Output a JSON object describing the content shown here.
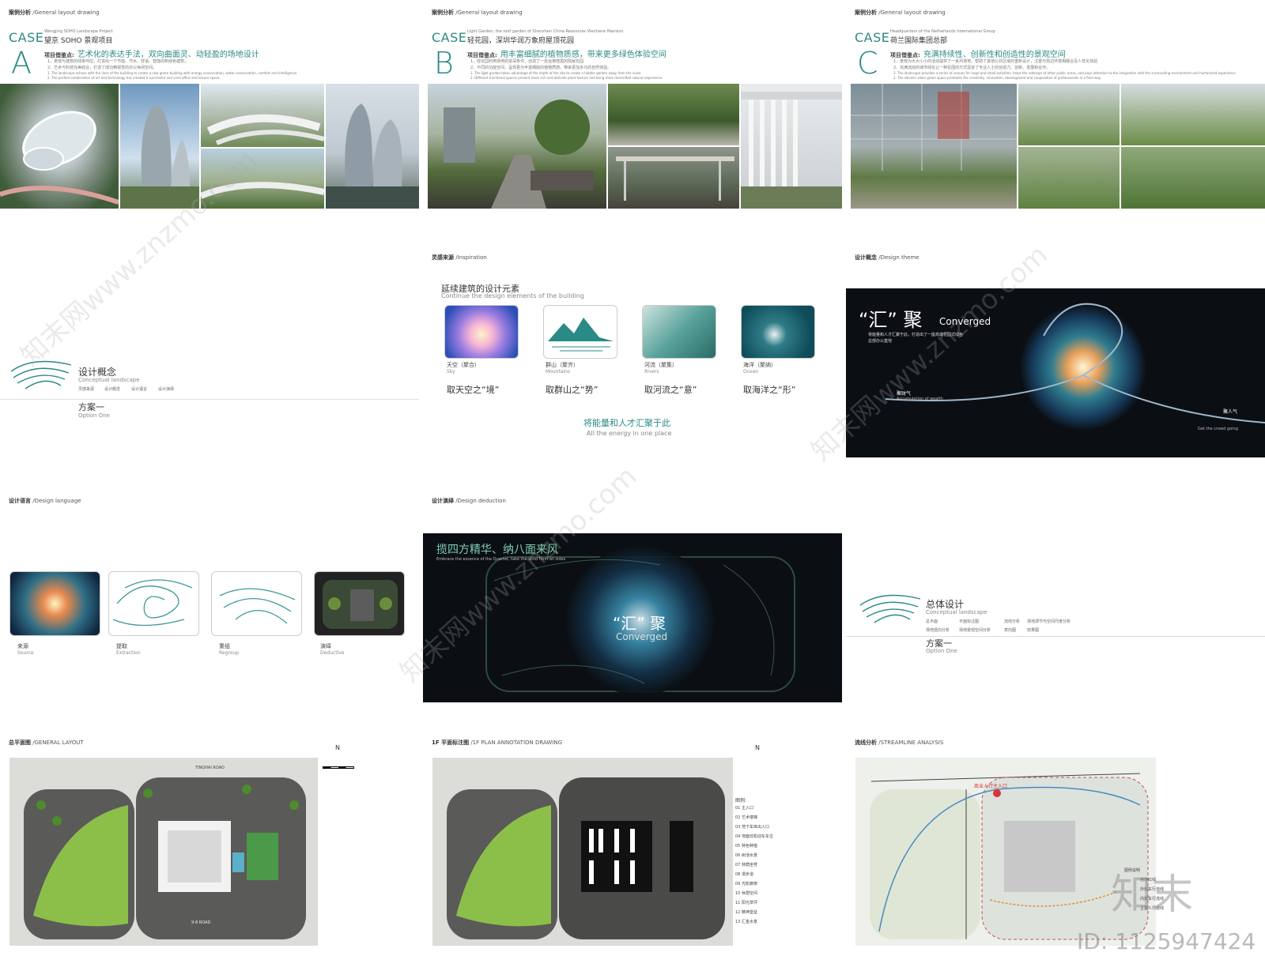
{
  "slides": {
    "caseA": {
      "sec": "案例分析",
      "sec_en": "/General layout drawing",
      "case": "CASE",
      "title": "望京 SOHO 景观项目",
      "title_en": "Wangjing SOHO Landscape Project",
      "letter": "A",
      "hl_label": "项目借鉴点:",
      "hl": "艺术化的表达手法，双向曲面灵、动轻盈的场地设计",
      "n1": "1、景观与建筑的线条呼应，打造出一个节能、节水、舒适、智能的新绿色建筑；",
      "n2": "2、艺术与科技完美结合，打造了成功精视觉的办公休闲空间。",
      "n3": "1. The landscape echoes with the lines of the building to create a new green building with energy conservation, water conservation, comfort and intelligence",
      "n4": "2. The perfect combination of art and technology has created a successful and vivid office and leisure space."
    },
    "caseB": {
      "sec": "案例分析",
      "sec_en": "/General layout drawing",
      "case": "CASE",
      "title": "轻花园，深圳华润万象府屋顶花园",
      "title_en": "Light Garden, the roof garden of Shenzhen China Resources Vientiane Mansion",
      "letter": "B",
      "hl_label": "项目借鉴点:",
      "hl": "用丰富细腻的植物质感，带来更多绿色体验空间",
      "n1": "1、轻花园利用场地的进深条件，创造了一处远离喧嚣的隐秘花园",
      "n2": "2、不同的功能空间，呈现更为丰富细腻的植物质感，带来更加多元的自然体验。",
      "n3": "1. The light garden takes advantage of the depth of the site to create a hidden garden away from the noise",
      "n4": "2. Different functional spaces present more rich and delicate plant texture and bring more diversified natural experience."
    },
    "caseC": {
      "sec": "案例分析",
      "sec_en": "/General layout drawing",
      "case": "CASE",
      "title": "荷兰国际集团总部",
      "title_en": "Headquarters of the Netherlands International Group",
      "letter": "C",
      "hl_label": "项目借鉴点:",
      "hl": "充满持续性、创新性和创造性的景观空间",
      "n1": "1、景观为大大小小的活动提供了一系列场地，帮助了其他公共区域的重新设计，注重与周边环境相融合及人性化体验",
      "n2": "2、充满流动的城市绿化让一种氛围的方式促进了专业人士的创造力、创新、发展和合作。",
      "n3": "1. The landscape provides a series of venues for large and small activities, helps the redesign of other public areas, and pays attention to the integration with the surrounding environment and humanized experience",
      "n4": "2. The vibrant urban green space promotes the creativity, innovation, development and cooperation of professionals in a fluid way."
    },
    "concept": {
      "title": "设计概念",
      "en": "Conceptual landscape",
      "subs": [
        "灵感来源",
        "设计概念",
        "设计语言",
        "设计演绎"
      ],
      "opt": "方案一",
      "opt_en": "Option  One"
    },
    "inspiration": {
      "sec": "灵感来源",
      "sec_en": "/Inspiration",
      "head": "延续建筑的设计元素",
      "head_en": "Continue the design elements of the building",
      "items": [
        {
          "cn": "天空（聚合）",
          "en": "Sky",
          "take": "取天空之“境”"
        },
        {
          "cn": "群山（聚齐）",
          "en": "Mountains",
          "take": "取群山之“势”"
        },
        {
          "cn": "河流（聚集）",
          "en": "Rivers",
          "take": "取河流之“意”"
        },
        {
          "cn": "海洋（聚纳）",
          "en": "Ocean",
          "take": "取海洋之“形”"
        }
      ],
      "bottom": "将能量和人才汇聚于此",
      "bottom_en": "All the energy in one place"
    },
    "theme": {
      "sec": "设计概念",
      "sec_en": "/Design theme",
      "big": "“汇” 聚",
      "big_en": "Converged",
      "desc1": "将能量和人才汇聚于此，打造出了一座高端花园式绿色",
      "desc2": "总部办公基地",
      "left": "聚财气",
      "left_en": "Accumulation of wealth",
      "right": "聚人气",
      "right_en": "Get the crowd going"
    },
    "language": {
      "sec": "设计语言",
      "sec_en": "/Design language",
      "items": [
        {
          "cn": "来源",
          "en": "Source"
        },
        {
          "cn": "提取",
          "en": "Extraction"
        },
        {
          "cn": "重组",
          "en": "Regroup"
        },
        {
          "cn": "演绎",
          "en": "Deductive"
        }
      ]
    },
    "deduction": {
      "sec": "设计演绎",
      "sec_en": "/Design deduction",
      "head": "揽四方精华、纳八面来风",
      "head_en": "Embrace the essence of the Quartet, take the wind from all sides",
      "center": "“汇” 聚",
      "center_en": "Converged"
    },
    "overall": {
      "title": "总体设计",
      "en": "Conceptual landscape",
      "subs1": [
        "总平面",
        "平面标注图",
        "流线分析",
        "场地调节与空间尺度分析"
      ],
      "subs2": [
        "场地竖向分析",
        "场地景观空间分析",
        "意向图",
        "效果图"
      ],
      "opt": "方案一",
      "opt_en": "Option  One"
    },
    "general": {
      "sec": "总平面图",
      "sec_en": "/GENERAL LAYOUT",
      "road1": "TINGHAI ROAD",
      "road2": "9-8 ROAD",
      "n": "N"
    },
    "annot": {
      "sec": "1F 平面标注图",
      "sec_en": "/1F PLAN ANNOTATION DRAWING",
      "legend_title": "图例:",
      "legend": [
        "01 主入口",
        "02 艺术楼梯",
        "03 地下车库出入口",
        "04 地面非机动车车位",
        "05 特色种植",
        "06 树池水景",
        "07 林荫坐凳",
        "08 漫步道",
        "09 光影廊架",
        "10 休憩空间",
        "11 阳光草坪",
        "12 精神堡垒",
        "13 汇金水景"
      ]
    },
    "stream": {
      "sec": "流线分析",
      "sec_en": "/STREAMLINE ANALYSIS",
      "entry": "商业人行主入口",
      "legend_title": "图例说明",
      "legend": [
        "用地红线",
        "外部车行流线",
        "内部车行流线",
        "主要人行流线"
      ]
    }
  },
  "watermark": {
    "text1": "知末网www.znzmo.com",
    "logo": "知末",
    "id": "ID: 1125947424"
  },
  "colors": {
    "teal": "#2a8a86",
    "dark": "#0b0f14"
  }
}
